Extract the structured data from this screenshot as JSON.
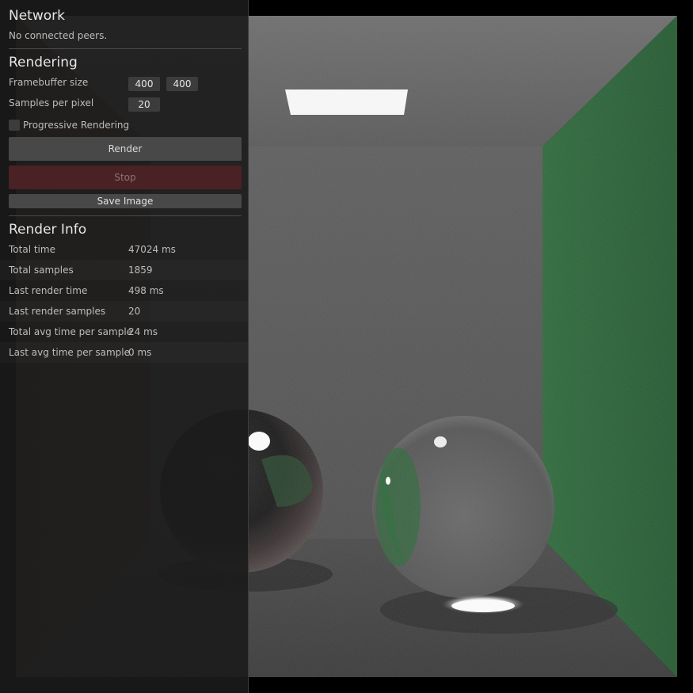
{
  "network": {
    "title": "Network",
    "status": "No connected peers."
  },
  "rendering": {
    "title": "Rendering",
    "framebuffer_label": "Framebuffer size",
    "framebuffer_width": "400",
    "framebuffer_height": "400",
    "samples_label": "Samples per pixel",
    "samples_value": "20",
    "progressive_label": "Progressive Rendering",
    "progressive_checked": false,
    "render_button": "Render",
    "stop_button": "Stop",
    "save_button": "Save Image"
  },
  "render_info": {
    "title": "Render Info",
    "rows": [
      {
        "label": "Total time",
        "value": "47024 ms"
      },
      {
        "label": "Total samples",
        "value": "1859"
      },
      {
        "label": "Last render time",
        "value": "498 ms"
      },
      {
        "label": "Last render samples",
        "value": "20"
      },
      {
        "label": "Total avg time per sample",
        "value": "24 ms"
      },
      {
        "label": "Last avg time per sample",
        "value": "0 ms"
      }
    ]
  },
  "colors": {
    "panel_bg": "#1b1b1b",
    "button_bg": "#484848",
    "stop_button_bg": "#4a2125",
    "green_wall": "#2f6a3c"
  }
}
